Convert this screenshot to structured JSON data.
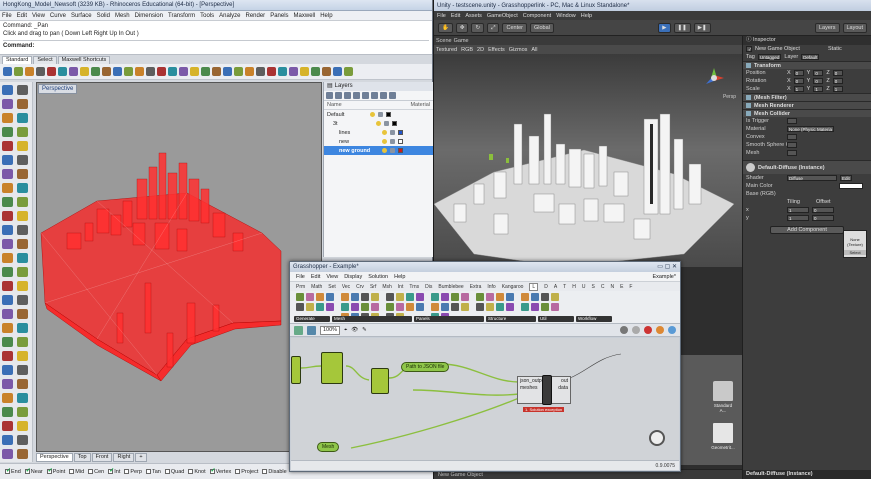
{
  "rhino": {
    "title": "HongKong_Model_Newsoft (3239 KB) - Rhinoceros Educational (64-bit) - [Perspective]",
    "menu": [
      "File",
      "Edit",
      "View",
      "Curve",
      "Surface",
      "Solid",
      "Mesh",
      "Dimension",
      "Transform",
      "Tools",
      "Analyze",
      "Render",
      "Panels",
      "Maxwell",
      "Help"
    ],
    "command_lines": [
      "Command: _Pan",
      "Click and drag to pan ( Down Left Right Up In Out )"
    ],
    "command_prompt": "Command:",
    "toolbar_tabs": [
      "Standard",
      "Select",
      "Maxwell Shortcuts"
    ],
    "viewport_label": "Perspective",
    "view_tabs": [
      "Perspective",
      "Top",
      "Front",
      "Right",
      "+"
    ],
    "osnaps": [
      {
        "label": "End",
        "on": true
      },
      {
        "label": "Near",
        "on": true
      },
      {
        "label": "Point",
        "on": true
      },
      {
        "label": "Mid",
        "on": false
      },
      {
        "label": "Cen",
        "on": false
      },
      {
        "label": "Int",
        "on": true
      },
      {
        "label": "Perp",
        "on": false
      },
      {
        "label": "Tan",
        "on": false
      },
      {
        "label": "Quad",
        "on": false
      },
      {
        "label": "Knot",
        "on": false
      },
      {
        "label": "Vertex",
        "on": true
      },
      {
        "label": "Project",
        "on": false
      },
      {
        "label": "Disable",
        "on": false
      }
    ],
    "layers": {
      "title": "Layers",
      "col_name": "Name",
      "col_material": "Material",
      "rows": [
        {
          "name": "Default",
          "indent": 0,
          "color": "#000000",
          "selected": false
        },
        {
          "name": "3t",
          "indent": 1,
          "color": "#000000",
          "selected": false
        },
        {
          "name": "lines",
          "indent": 2,
          "color": "#2255cc",
          "selected": false
        },
        {
          "name": "new",
          "indent": 2,
          "color": "#ffffff",
          "selected": false
        },
        {
          "name": "new ground",
          "indent": 2,
          "color": "#d01818",
          "selected": true
        }
      ]
    },
    "colors": {
      "model": "#ff1a1a",
      "viewport_bg": "#9a9a9a"
    }
  },
  "unity": {
    "title": "Unity - testscene.unity - Grasshopperlink - PC, Mac & Linux Standalone*",
    "menu": [
      "File",
      "Edit",
      "Assets",
      "GameObject",
      "Component",
      "Window",
      "Help"
    ],
    "toolbar": {
      "pivot": "Center",
      "space": "Global",
      "layers": "Layers",
      "layout": "Layout"
    },
    "scene_tabs": [
      "Scene",
      "Game"
    ],
    "scene_bar": [
      "Textured",
      "RGB",
      "2D",
      "Effects",
      "Gizmos",
      "All"
    ],
    "persp_label": "Persp",
    "inspector": {
      "title": "Inspector",
      "object_name": "New Game Object",
      "static_label": "Static",
      "tag": "Untagged",
      "layer": "Default",
      "transform_title": "Transform",
      "transform_rows": [
        {
          "label": "Position",
          "x": "0",
          "y": "0",
          "z": "0"
        },
        {
          "label": "Rotation",
          "x": "0",
          "y": "0",
          "z": "0"
        },
        {
          "label": "Scale",
          "x": "1",
          "y": "1",
          "z": "1"
        }
      ],
      "mesh_filter": "(Mesh Filter)",
      "mesh_renderer": "Mesh Renderer",
      "mesh_collider": "Mesh Collider",
      "collider_rows": [
        {
          "label": "Is Trigger",
          "value": ""
        },
        {
          "label": "Material",
          "value": "None (Physic Materia"
        },
        {
          "label": "Convex",
          "value": ""
        },
        {
          "label": "Smooth Sphere Coll",
          "value": ""
        },
        {
          "label": "Mesh",
          "value": ""
        }
      ],
      "material_name": "Default-Diffuse (Instance)",
      "shader_label": "Shader",
      "shader_value": "Diffuse",
      "edit_label": "Edit",
      "main_color": "Main Color",
      "base_rgb": "Base (RGB)",
      "tiling": "Tiling",
      "offset": "Offset",
      "tex_x": {
        "tiling": "1",
        "offset": "0"
      },
      "tex_y": {
        "tiling": "1",
        "offset": "0"
      },
      "tex_none": "None (Texture)",
      "tex_select": "Select",
      "add_component": "Add Component",
      "footer": "Default-Diffuse (Instance)"
    },
    "project_items": [
      {
        "label": "Standard A...",
        "kind": "folder"
      },
      {
        "label": "Geometrit...",
        "kind": "file"
      }
    ],
    "bottom_label": "New Game Object",
    "colors": {
      "bg": "#2e2e2e",
      "scene_sky": "#3b3b3b",
      "buildings": "#f2f2f2"
    }
  },
  "grasshopper": {
    "title": "Grasshopper - Example*",
    "menu": [
      "File",
      "Edit",
      "View",
      "Display",
      "Solution",
      "Help"
    ],
    "doc_name": "Example*",
    "categories": [
      "Prm",
      "Math",
      "Set",
      "Vec",
      "Crv",
      "Srf",
      "Msh",
      "Int",
      "Trns",
      "Dis",
      "Bumblebee",
      "Extra",
      "Info",
      "Kangaroo",
      "L",
      "D",
      "A",
      "T",
      "H",
      "U",
      "S",
      "C",
      "N",
      "E",
      "F"
    ],
    "active_category": "L",
    "panels": [
      "Generate",
      "Mesh",
      "Panels",
      "Structure",
      "Util",
      "Workflow"
    ],
    "zoom": "100%",
    "nodes": {
      "json_out": "json_output",
      "meshes": "meshes",
      "out": "out",
      "data": "data",
      "pill_top": "Path to JSON file",
      "pill_bottom": "Mesh",
      "error_note": "1. Solution exception"
    },
    "status": "0.9.0075"
  }
}
